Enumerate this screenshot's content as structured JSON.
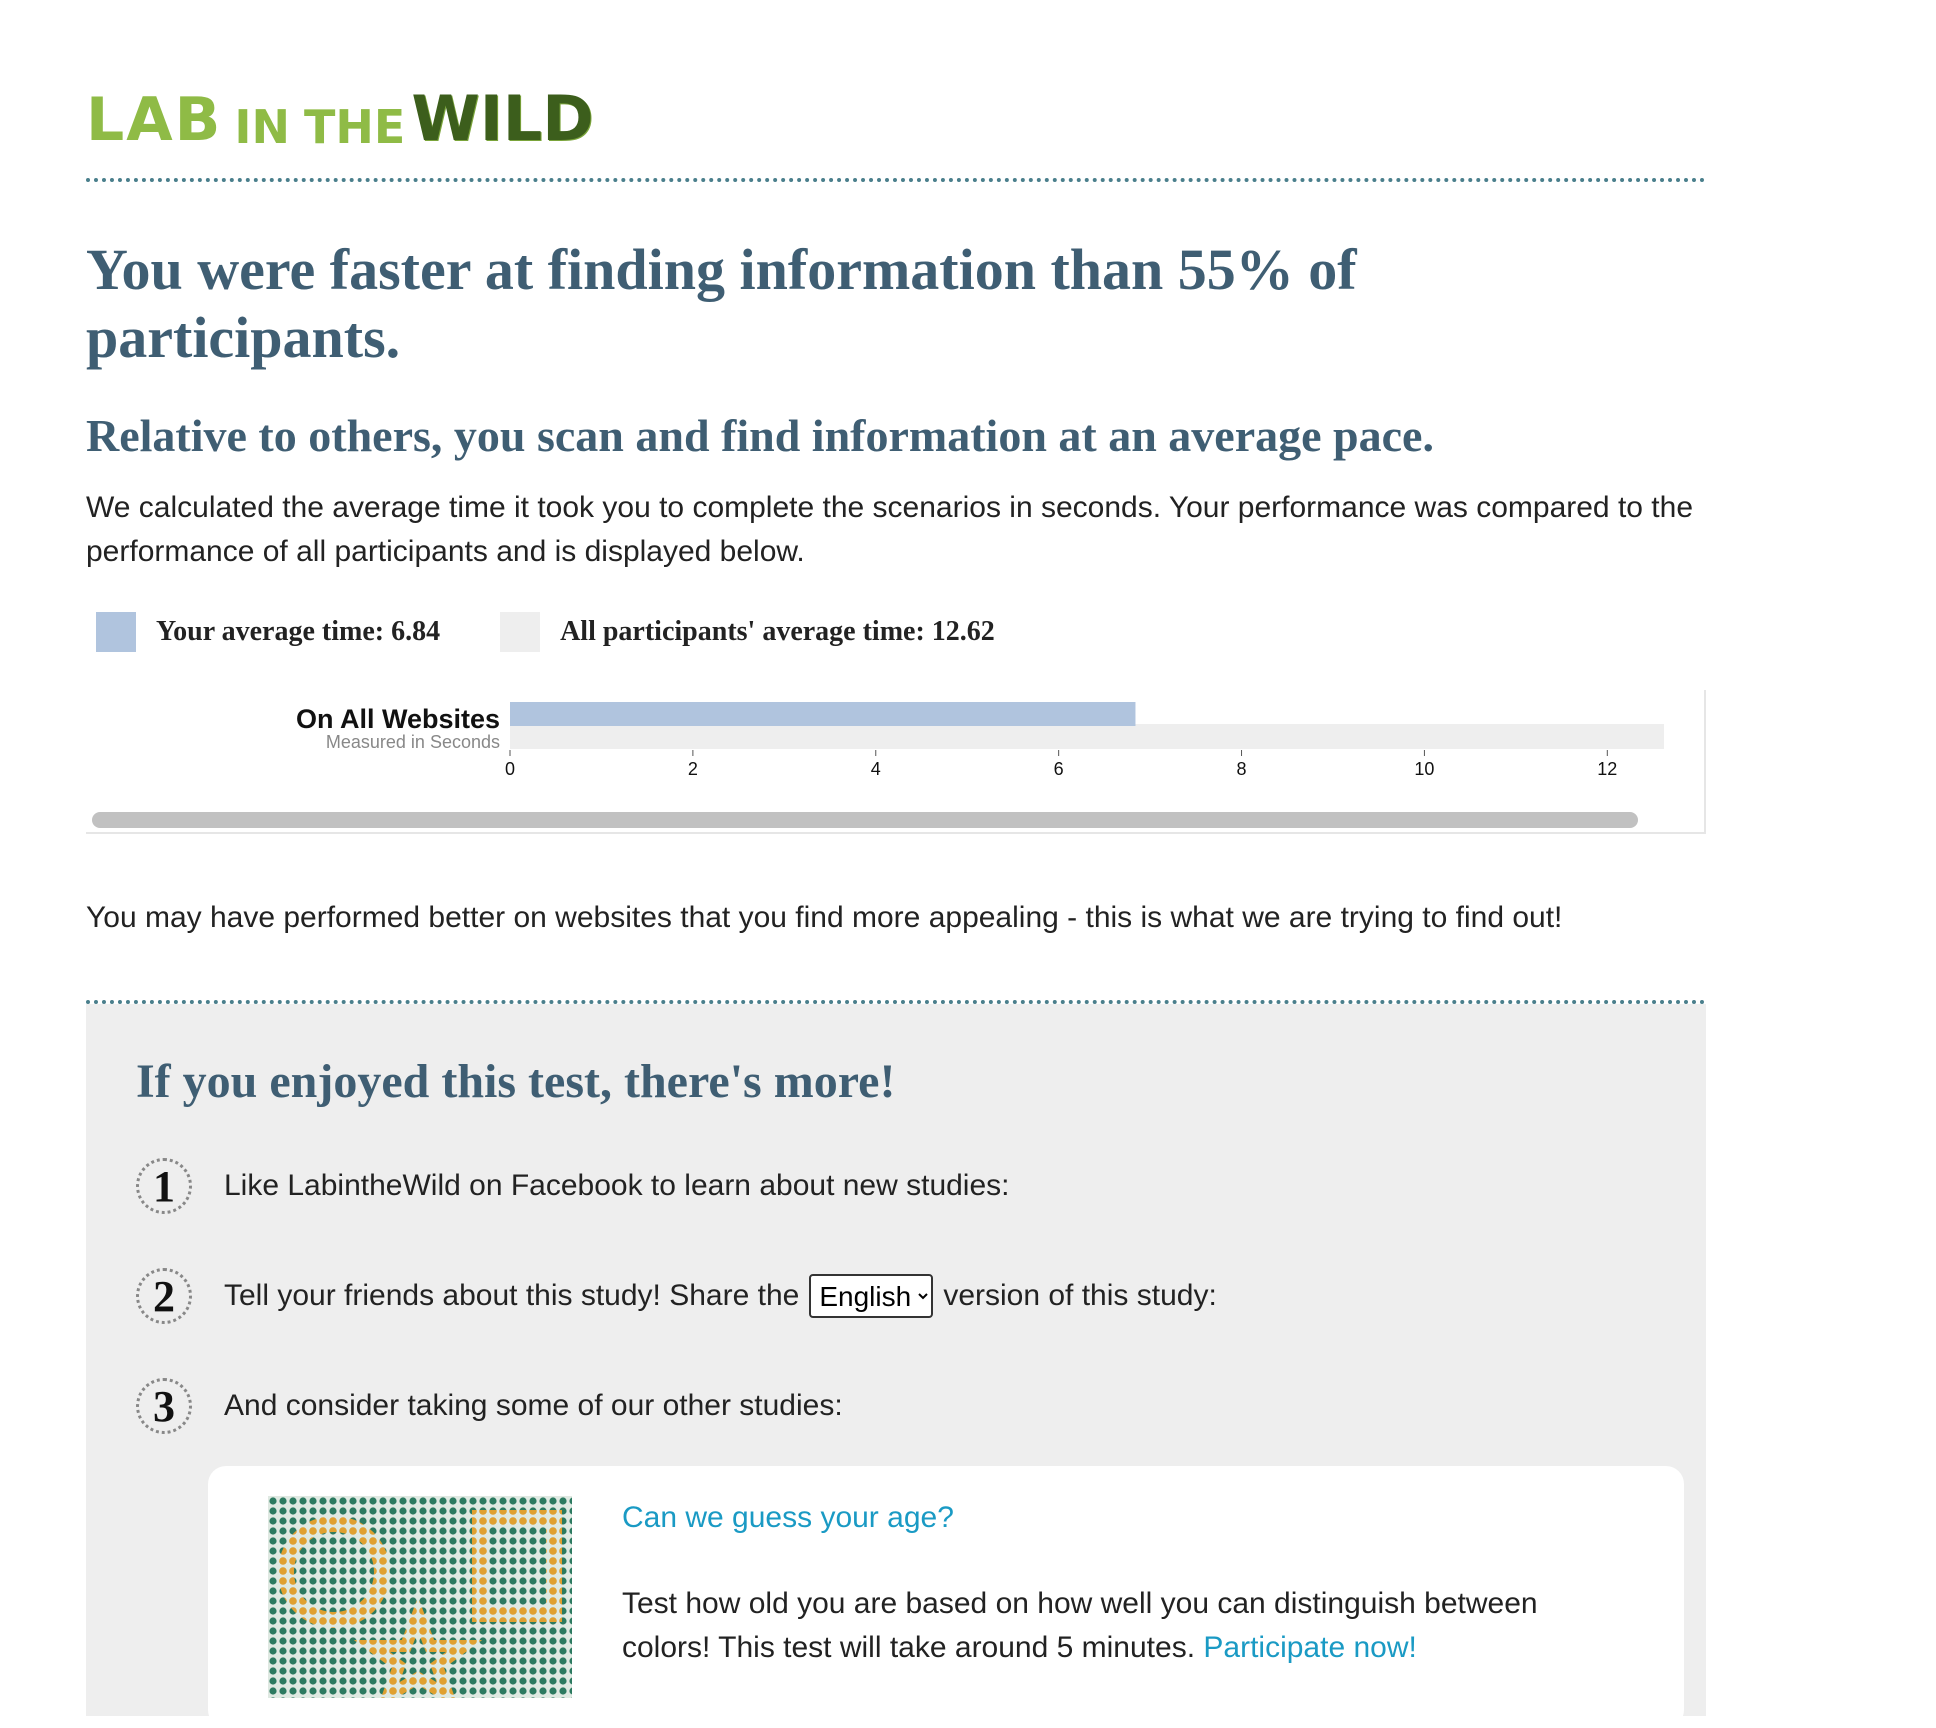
{
  "logo": {
    "lab": "LAB",
    "in": "IN",
    "the": "THE",
    "wild": "WILD"
  },
  "headline": "You were faster at finding information than 55% of participants.",
  "subheadline": "Relative to others, you scan and find information at an average pace.",
  "description": "We calculated the average time it took you to complete the scenarios in seconds. Your performance was compared to the performance of all participants and is displayed below.",
  "legend": {
    "yours": {
      "label": "Your average time: 6.84",
      "color": "#b0c4de"
    },
    "all": {
      "label": "All participants' average time: 12.62",
      "color": "#eeeeee"
    }
  },
  "chart_data": {
    "type": "bar",
    "categories": [
      "On All Websites"
    ],
    "category_sublabel": "Measured in Seconds",
    "series": [
      {
        "name": "Your average time",
        "values": [
          6.84
        ],
        "color": "#b0c4de"
      },
      {
        "name": "All participants' average time",
        "values": [
          12.62
        ],
        "color": "#eeeeee"
      }
    ],
    "xticks": [
      0,
      2,
      4,
      6,
      8,
      10,
      12
    ],
    "xlim": [
      0,
      12.62
    ],
    "orientation": "horizontal"
  },
  "appeal_text": "You may have performed better on websites that you find more appealing - this is what we are trying to find out!",
  "more": {
    "title": "If you enjoyed this test, there's more!",
    "steps": [
      {
        "number": "1",
        "text": "Like LabintheWild on Facebook to learn about new studies:"
      },
      {
        "number": "2",
        "text_before": "Tell your friends about this study! Share the",
        "select_value": "English",
        "text_after": "version of this study:"
      },
      {
        "number": "3",
        "text": "And consider taking some of our other studies:"
      }
    ],
    "study": {
      "title": "Can we guess your age?",
      "description": "Test how old you are based on how well you can distinguish between colors! This test will take around 5 minutes.",
      "cta": "Participate now!"
    }
  }
}
